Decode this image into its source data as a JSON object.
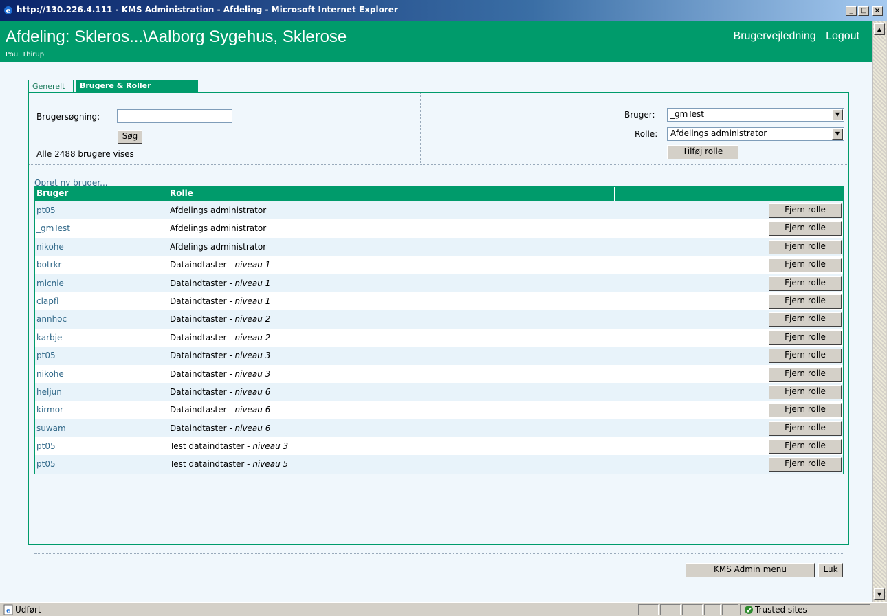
{
  "window": {
    "title": "http://130.226.4.111 - KMS Administration - Afdeling - Microsoft Internet Explorer"
  },
  "header": {
    "title": "Afdeling: Skleros...\\Aalborg Sygehus, Sklerose",
    "help_link": "Brugervejledning",
    "logout_link": "Logout",
    "user_name": "Poul Thirup"
  },
  "tabs": [
    {
      "label": "Generelt",
      "active": false
    },
    {
      "label": "Brugere & Roller",
      "active": true
    }
  ],
  "search": {
    "label": "Brugersøgning:",
    "value": "",
    "button": "Søg",
    "result_text": "Alle 2488 brugere vises"
  },
  "assign": {
    "user_label": "Bruger:",
    "user_value": "_gmTest",
    "role_label": "Rolle:",
    "role_value": "Afdelings administrator",
    "add_button": "Tilføj rolle"
  },
  "create_link": "Opret ny bruger...",
  "table": {
    "columns": [
      "Bruger",
      "Rolle"
    ],
    "remove_label": "Fjern rolle",
    "rows": [
      {
        "user": "pt05",
        "role": "Afdelings administrator",
        "level": ""
      },
      {
        "user": "_gmTest",
        "role": "Afdelings administrator",
        "level": ""
      },
      {
        "user": "nikohe",
        "role": "Afdelings administrator",
        "level": ""
      },
      {
        "user": "botrkr",
        "role": "Dataindtaster - ",
        "level": "niveau 1"
      },
      {
        "user": "micnie",
        "role": "Dataindtaster - ",
        "level": "niveau 1"
      },
      {
        "user": "clapfl",
        "role": "Dataindtaster - ",
        "level": "niveau 1"
      },
      {
        "user": "annhoc",
        "role": "Dataindtaster - ",
        "level": "niveau 2"
      },
      {
        "user": "karbje",
        "role": "Dataindtaster - ",
        "level": "niveau 2"
      },
      {
        "user": "pt05",
        "role": "Dataindtaster - ",
        "level": "niveau 3"
      },
      {
        "user": "nikohe",
        "role": "Dataindtaster - ",
        "level": "niveau 3"
      },
      {
        "user": "heljun",
        "role": "Dataindtaster - ",
        "level": "niveau 6"
      },
      {
        "user": "kirmor",
        "role": "Dataindtaster - ",
        "level": "niveau 6"
      },
      {
        "user": "suwam",
        "role": "Dataindtaster - ",
        "level": "niveau 6"
      },
      {
        "user": "pt05",
        "role": "Test dataindtaster - ",
        "level": "niveau 3"
      },
      {
        "user": "pt05",
        "role": "Test dataindtaster - ",
        "level": "niveau 5"
      }
    ]
  },
  "footer": {
    "menu_button": "KMS Admin menu",
    "close_button": "Luk"
  },
  "statusbar": {
    "status": "Udført",
    "zone": "Trusted sites"
  },
  "colors": {
    "brand": "#009b6b",
    "link": "#336a8a",
    "background": "#f0f7fc"
  }
}
